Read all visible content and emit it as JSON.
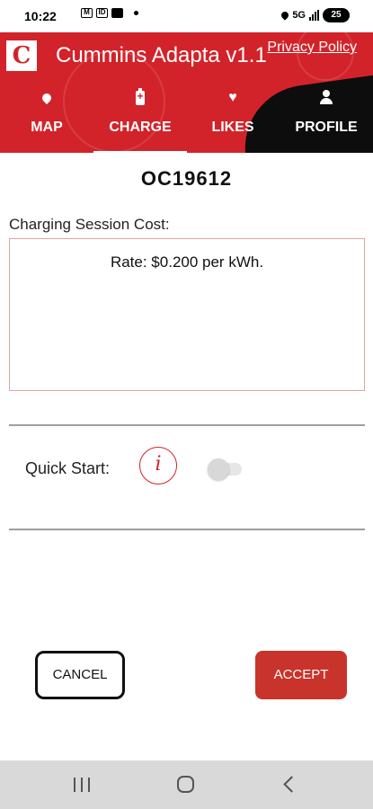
{
  "status_bar": {
    "time": "10:22",
    "left_icons": [
      "M",
      "ID",
      "▶"
    ],
    "network": "5G",
    "battery": "25"
  },
  "header": {
    "logo_letter": "C",
    "app_title": "Cummins Adapta v1.1",
    "privacy_link": "Privacy Policy",
    "tabs": [
      {
        "label": "MAP",
        "icon": "map-pin-icon"
      },
      {
        "label": "CHARGE",
        "icon": "battery-charge-icon"
      },
      {
        "label": "LIKES",
        "icon": "heart-icon"
      },
      {
        "label": "PROFILE",
        "icon": "profile-icon"
      }
    ],
    "active_tab": "CHARGE",
    "colors": {
      "brand_red": "#d2232a",
      "accent_black": "#0d0d0d"
    }
  },
  "charge": {
    "station_id": "OC19612",
    "cost_label": "Charging Session Cost:",
    "rate_text": "Rate: $0.200 per kWh.",
    "quick_start_label": "Quick Start:",
    "info_glyph": "i",
    "quick_start_enabled": false,
    "cancel_label": "CANCEL",
    "accept_label": "ACCEPT"
  },
  "nav_bar": {
    "icons": [
      "recents-icon",
      "home-icon",
      "back-icon"
    ]
  }
}
